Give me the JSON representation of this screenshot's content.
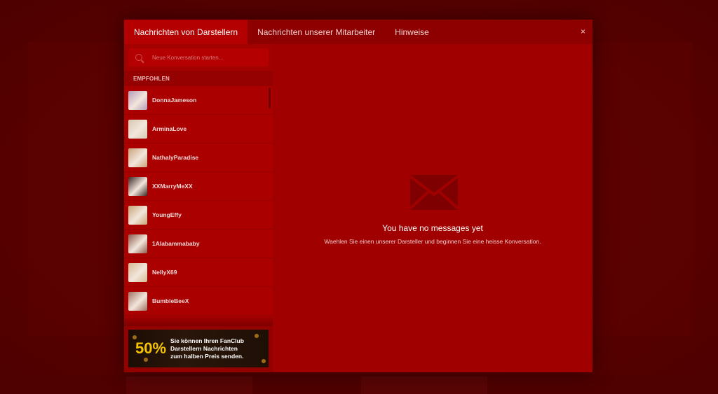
{
  "tabs": [
    {
      "label": "Nachrichten von Darstellern",
      "active": true
    },
    {
      "label": "Nachrichten unserer Mitarbeiter",
      "active": false
    },
    {
      "label": "Hinweise",
      "active": false
    }
  ],
  "close_label": "×",
  "search": {
    "placeholder": "Neue Konversation starten..."
  },
  "section_label": "EMPFOHLEN",
  "performers": [
    {
      "name": "DonnaJameson",
      "avatar_color": "#b89ab8"
    },
    {
      "name": "ArminaLove",
      "avatar_color": "#d8c8b0"
    },
    {
      "name": "NathalyParadise",
      "avatar_color": "#c9a27a"
    },
    {
      "name": "XXMarryMeXX",
      "avatar_color": "#3a2624"
    },
    {
      "name": "YoungEffy",
      "avatar_color": "#c8a476"
    },
    {
      "name": "1Alabammababy",
      "avatar_color": "#8c5a4a"
    },
    {
      "name": "NellyX69",
      "avatar_color": "#d6b890"
    },
    {
      "name": "BumbleBeeX",
      "avatar_color": "#a07060"
    }
  ],
  "banner": {
    "percent": "50%",
    "line1": "Sie können Ihren FanClub",
    "line2": "Darstellern Nachrichten",
    "line3": "zum halben Preis senden."
  },
  "empty_state": {
    "icon": "envelope-icon",
    "title": "You have no messages yet",
    "subtitle": "Waehlen Sie einen unserer Darsteller und beginnen Sie eine heisse Konversation."
  },
  "colors": {
    "modal_bg": "#9c0000",
    "tab_active": "#b40000",
    "backdrop": "#5e0000",
    "banner_accent": "#f5c400"
  }
}
